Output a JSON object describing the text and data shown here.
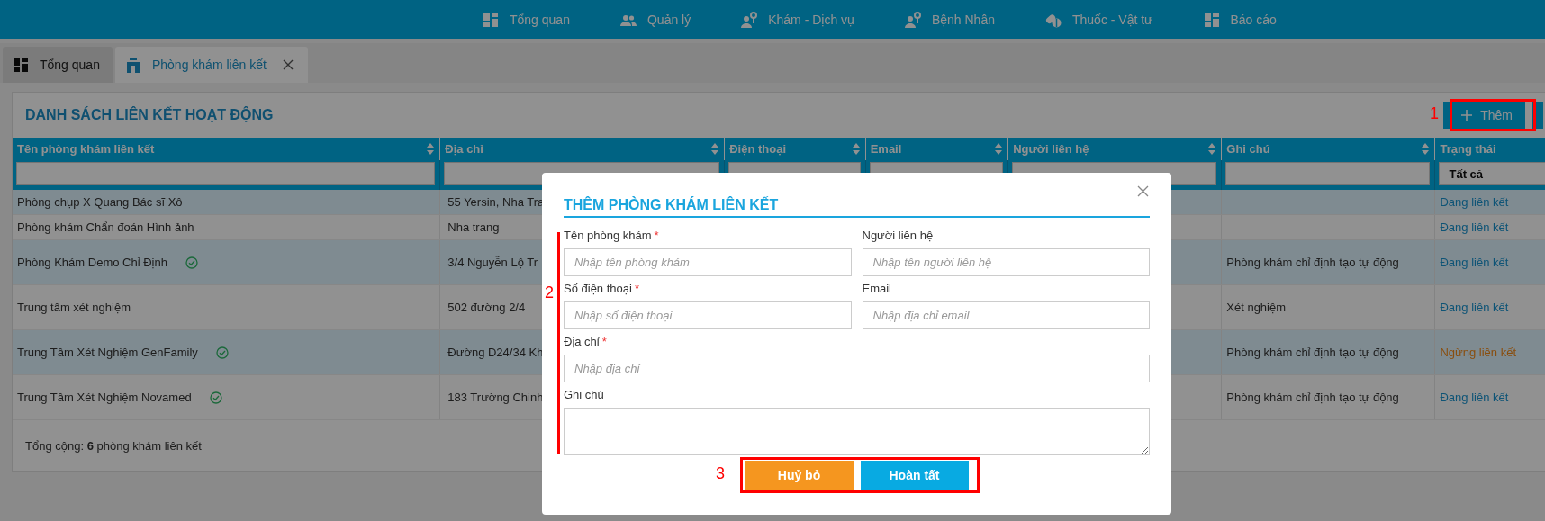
{
  "top_nav": [
    {
      "label": "Tổng quan"
    },
    {
      "label": "Quản lý"
    },
    {
      "label": "Khám - Dịch vụ"
    },
    {
      "label": "Bệnh Nhân"
    },
    {
      "label": "Thuốc - Vật tư"
    },
    {
      "label": "Báo cáo"
    }
  ],
  "tabs": [
    {
      "label": "Tổng quan",
      "selected": false,
      "closable": false
    },
    {
      "label": "Phòng khám liên kết",
      "selected": true,
      "closable": true
    }
  ],
  "panel": {
    "title": "DANH SÁCH LIÊN KẾT HOẠT ĐỘNG",
    "add_button": "Thêm"
  },
  "table": {
    "columns": [
      {
        "label": "Tên phòng khám liên kết",
        "sortable": true
      },
      {
        "label": "Địa chỉ",
        "sortable": true
      },
      {
        "label": "Điện thoại",
        "sortable": true
      },
      {
        "label": "Email",
        "sortable": true
      },
      {
        "label": "Người liên hệ",
        "sortable": true
      },
      {
        "label": "Ghi chú",
        "sortable": true
      },
      {
        "label": "Trạng thái",
        "sortable": false,
        "filter_value": "Tất cả"
      }
    ],
    "rows": [
      {
        "name": "Phòng chụp X Quang Bác sĩ Xô",
        "verified": false,
        "address": "55 Yersin, Nha Tra",
        "status": {
          "label": "Đang liên kết",
          "kind": "active"
        }
      },
      {
        "name": "Phòng khám Chẩn đoán Hình ảnh",
        "verified": false,
        "address": "Nha trang",
        "status": {
          "label": "Đang liên kết",
          "kind": "active"
        }
      },
      {
        "name": "Phòng Khám Demo Chỉ Định",
        "verified": true,
        "address": "3/4 Nguyễn Lộ Tr",
        "note": "Phòng khám chỉ định tạo tự động",
        "status": {
          "label": "Đang liên kết",
          "kind": "active"
        }
      },
      {
        "name": "Trung tâm xét nghiệm",
        "verified": false,
        "address": "502 đường 2/4",
        "note": "Xét nghiệm",
        "status": {
          "label": "Đang liên kết",
          "kind": "active"
        }
      },
      {
        "name": "Trung Tâm Xét Nghiệm GenFamily",
        "verified": true,
        "address": "Đường D24/34 Kh",
        "note": "Phòng khám chỉ định tạo tự động",
        "status": {
          "label": "Ngừng liên kết",
          "kind": "inactive"
        }
      },
      {
        "name": "Trung Tâm Xét Nghiệm Novamed",
        "verified": true,
        "address": "183 Trường Chinh",
        "note": "Phòng khám chỉ định tạo tự động",
        "status": {
          "label": "Đang liên kết",
          "kind": "active"
        }
      }
    ],
    "footer": "Tổng cộng: **6** phòng khám liên kết"
  },
  "dialog": {
    "title": "THÊM PHÒNG KHÁM LIÊN KẾT",
    "field_rows": [
      [
        {
          "label": "Tên phòng khám",
          "required_mark": "*",
          "kind": "input",
          "placeholder": "Nhập tên phòng khám"
        },
        {
          "label": "Người liên hệ",
          "kind": "input",
          "placeholder": "Nhập tên người liên hệ"
        }
      ],
      [
        {
          "label": "Số điện thoại",
          "required_mark": "*",
          "kind": "input",
          "placeholder": "Nhập số điện thoại"
        },
        {
          "label": "Email",
          "kind": "input",
          "placeholder": "Nhập địa chỉ email"
        }
      ],
      [
        {
          "label": "Địa chỉ",
          "required_mark": "*",
          "kind": "input",
          "placeholder": "Nhập địa chỉ"
        }
      ],
      [
        {
          "label": "Ghi chú",
          "kind": "textarea"
        }
      ]
    ],
    "buttons": [
      {
        "label": "Huỷ bỏ",
        "kind": "cancel"
      },
      {
        "label": "Hoàn tất",
        "kind": "submit"
      }
    ]
  },
  "annotations": [
    {
      "label": "1"
    },
    {
      "label": "2"
    },
    {
      "label": "3"
    }
  ]
}
